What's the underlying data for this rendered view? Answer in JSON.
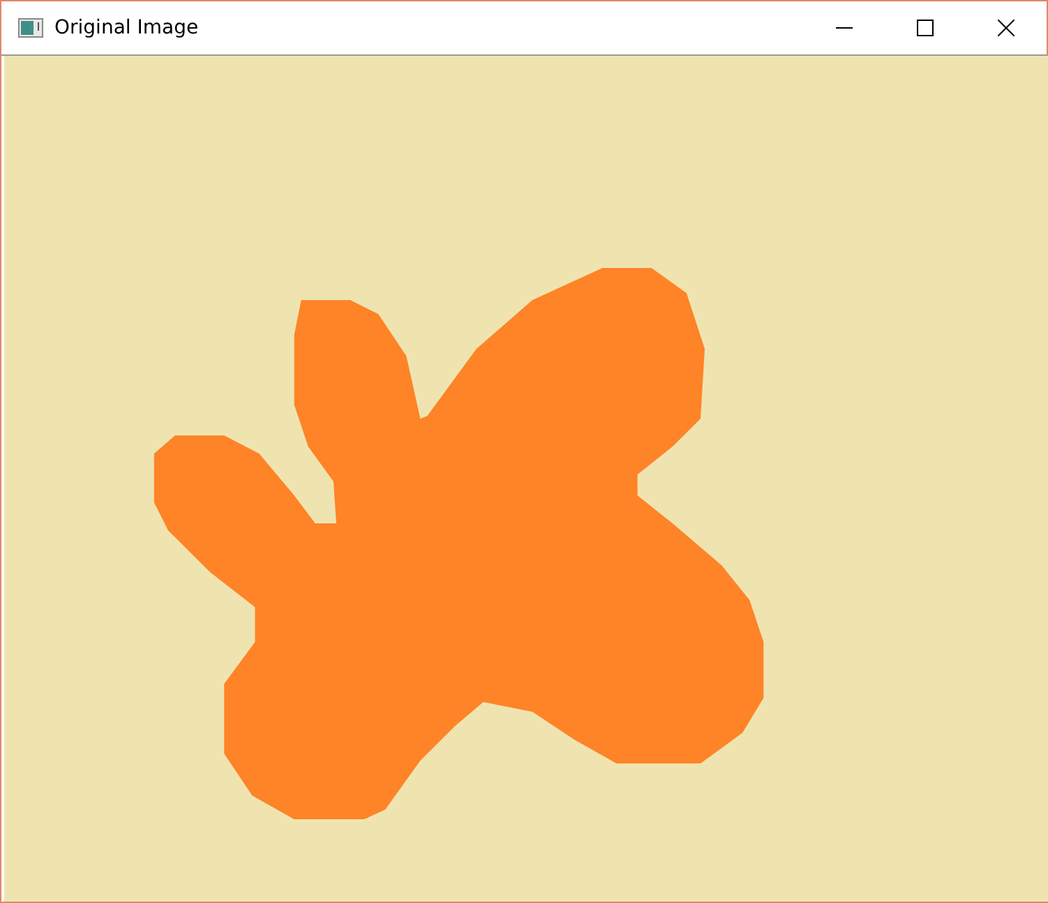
{
  "window": {
    "title": "Original Image"
  }
}
